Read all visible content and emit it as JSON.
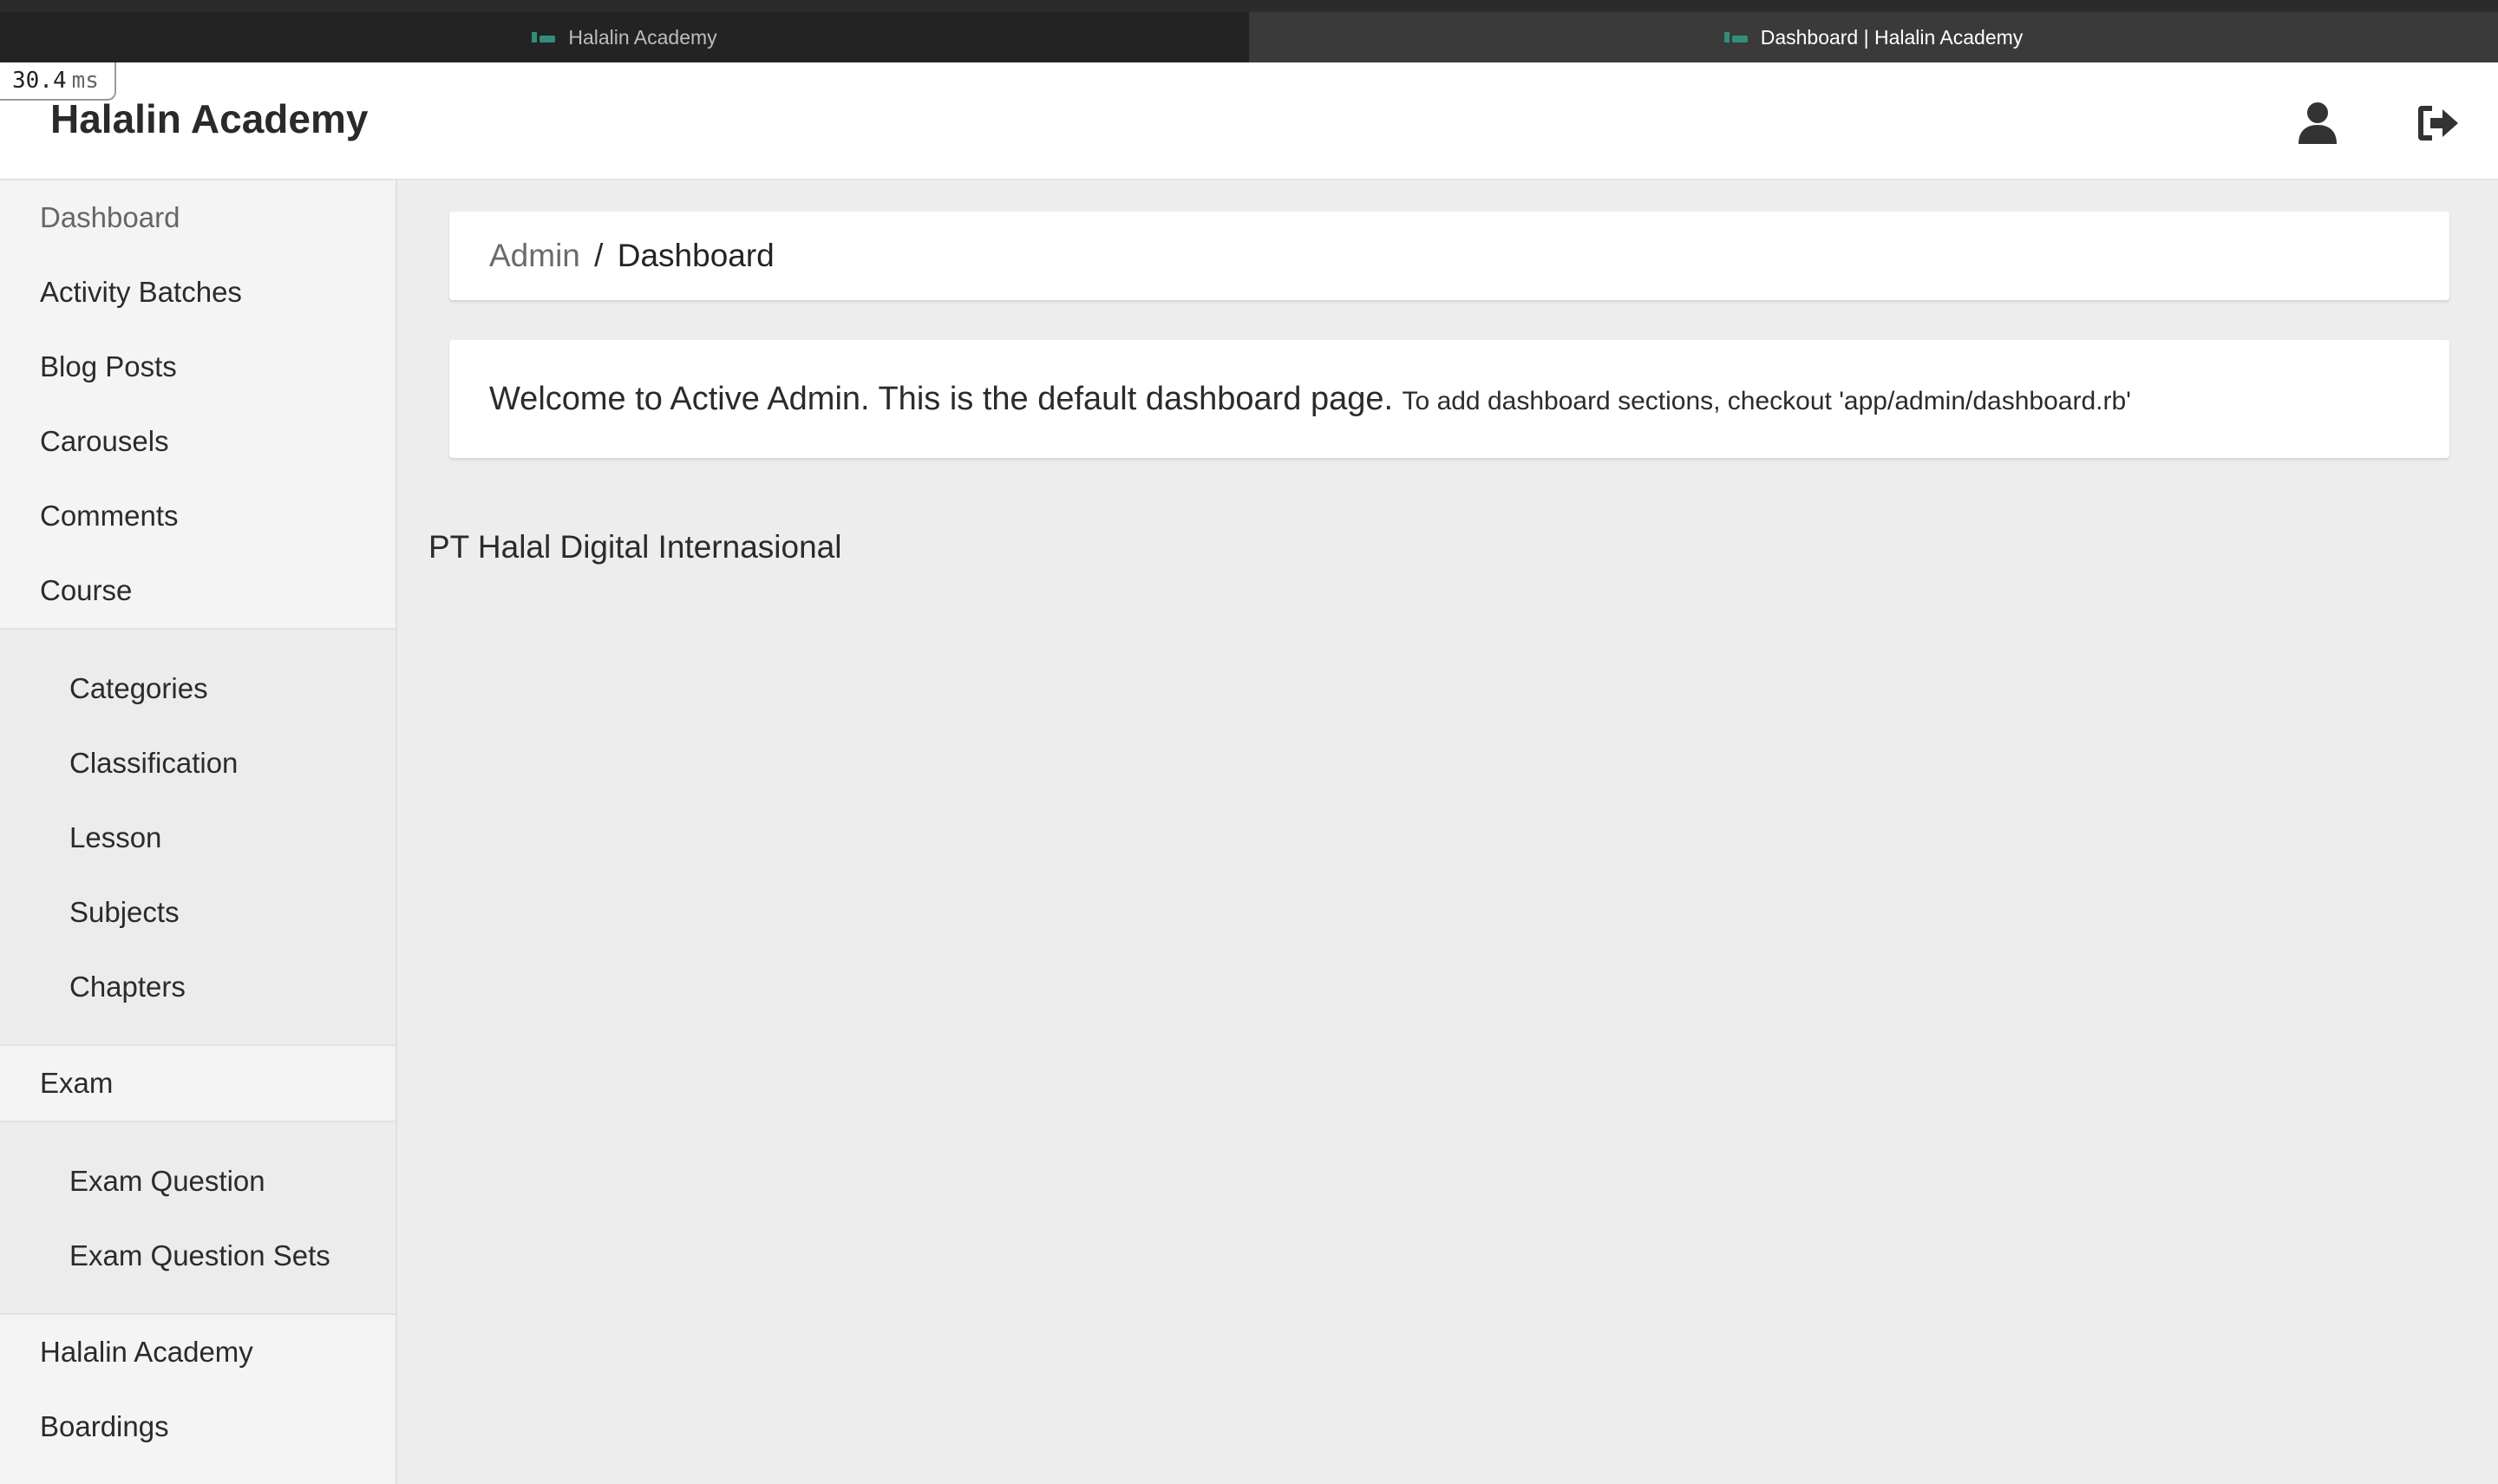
{
  "browser": {
    "tabs": [
      {
        "title": "Halalin Academy",
        "active": false
      },
      {
        "title": "Dashboard | Halalin Academy",
        "active": true
      }
    ]
  },
  "timing": {
    "value": "30.4",
    "unit": "ms"
  },
  "header": {
    "title": "Halalin Academy",
    "icons": [
      "user-icon",
      "logout-icon"
    ]
  },
  "sidebar": {
    "items": [
      {
        "label": "Dashboard"
      },
      {
        "label": "Activity Batches"
      },
      {
        "label": "Blog Posts"
      },
      {
        "label": "Carousels"
      },
      {
        "label": "Comments"
      },
      {
        "label": "Course"
      }
    ],
    "course_children": [
      {
        "label": "Categories"
      },
      {
        "label": "Classification"
      },
      {
        "label": "Lesson"
      },
      {
        "label": "Subjects"
      },
      {
        "label": "Chapters"
      }
    ],
    "exam": {
      "label": "Exam"
    },
    "exam_children": [
      {
        "label": "Exam Question"
      },
      {
        "label": "Exam Question Sets"
      }
    ],
    "bottom_items": [
      {
        "label": "Halalin Academy"
      },
      {
        "label": "Boardings"
      }
    ]
  },
  "breadcrumb": {
    "parent": "Admin",
    "separator": "/",
    "current": "Dashboard"
  },
  "welcome": {
    "main": "Welcome to Active Admin. This is the default dashboard page.",
    "note": "To add dashboard sections, checkout 'app/admin/dashboard.rb'"
  },
  "footer": {
    "text": "PT Halal Digital Internasional"
  },
  "colors": {
    "header_bg": "#ffffff",
    "sidebar_bg": "#f4f4f4",
    "content_bg": "#ededed",
    "tab_active_bg": "#3a3a3a",
    "tab_inactive_bg": "#232323"
  }
}
